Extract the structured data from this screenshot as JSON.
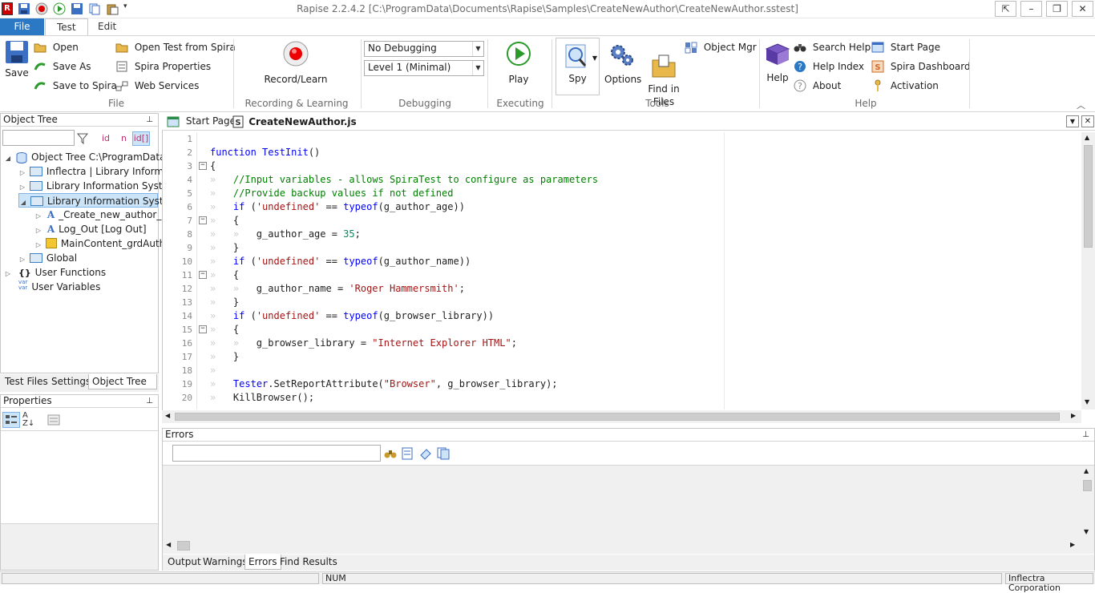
{
  "window": {
    "title": "Rapise 2.2.4.2 [C:\\ProgramData\\Documents\\Rapise\\Samples\\CreateNewAuthor\\CreateNewAuthor.sstest]"
  },
  "ribbon_tabs": [
    "File",
    "Test",
    "Edit"
  ],
  "ribbon": {
    "file_group": {
      "label": "File",
      "save": "Save",
      "open": "Open",
      "save_as": "Save As",
      "save_to_spira": "Save to Spira",
      "open_test_from_spira": "Open Test from Spira",
      "spira_properties": "Spira Properties",
      "web_services": "Web Services"
    },
    "recording_group": {
      "label": "Recording & Learning",
      "record_learn": "Record/Learn"
    },
    "debugging_group": {
      "label": "Debugging",
      "debug_mode": "No Debugging",
      "log_level": "Level 1 (Minimal)"
    },
    "executing_group": {
      "label": "Executing",
      "play": "Play"
    },
    "tools_group": {
      "label": "Tools",
      "spy": "Spy",
      "options": "Options",
      "find_in_files": "Find in\nFiles",
      "object_mgr": "Object Mgr"
    },
    "help_group": {
      "label": "Help",
      "help": "Help",
      "search_help": "Search Help",
      "help_index": "Help Index",
      "about": "About",
      "start_page": "Start Page",
      "spira_dashboard": "Spira Dashboard",
      "activation": "Activation"
    }
  },
  "object_tree": {
    "title": "Object Tree",
    "filter_buttons": [
      "id",
      "n",
      "id[]"
    ],
    "items": [
      {
        "label": "Object Tree C:\\ProgramData\\"
      },
      {
        "label": "Inflectra | Library Informati"
      },
      {
        "label": "Library Information Syste"
      },
      {
        "label": "Library Information Syste"
      },
      {
        "label": "_Create_new_author_"
      },
      {
        "label": "Log_Out [Log Out]"
      },
      {
        "label": "MainContent_grdAuth"
      },
      {
        "label": "Global"
      },
      {
        "label": "User Functions"
      },
      {
        "label": "User Variables"
      }
    ],
    "var_icon_text": "var\nvar",
    "tabs": [
      "Test Files",
      "Settings",
      "Object Tree"
    ]
  },
  "properties": {
    "title": "Properties"
  },
  "editor": {
    "tabs": [
      "Start Page",
      "CreateNewAuthor.js"
    ],
    "line_numbers": [
      "1",
      "2",
      "3",
      "4",
      "5",
      "6",
      "7",
      "8",
      "9",
      "10",
      "11",
      "12",
      "13",
      "14",
      "15",
      "16",
      "17",
      "18",
      "19",
      "20"
    ]
  },
  "errors_panel": {
    "title": "Errors",
    "tabs": [
      "Output",
      "Warnings",
      "Errors",
      "Find Results"
    ]
  },
  "status_bar": {
    "num": "NUM",
    "company": "Inflectra Corporation"
  },
  "colors": {
    "accent": "#2b78c5",
    "selection": "#cce4f7"
  }
}
